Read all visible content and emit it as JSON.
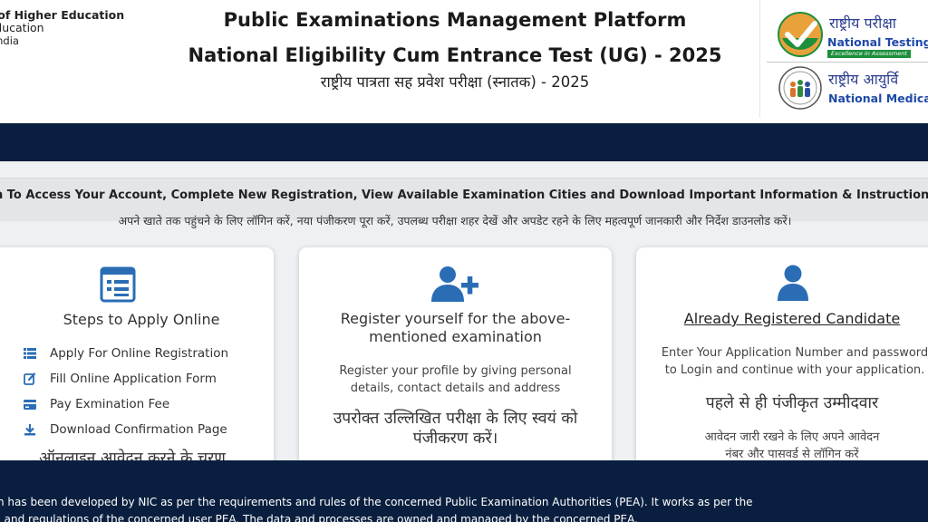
{
  "header": {
    "ministry_line1": "nt of Higher Education",
    "ministry_line2": "f Education",
    "ministry_line3": "of India",
    "title_line1": "Public Examinations Management Platform",
    "title_line2": "National Eligibility Cum Entrance Test (UG) - 2025",
    "title_line3": "राष्ट्रीय पात्रता सह प्रवेश परीक्षा (स्नातक) - 2025",
    "nta_hindi": "राष्ट्रीय परीक्षा",
    "nta_english": "National Testing",
    "nta_tagline": "Excellence in Assessment",
    "nmc_hindi": "राष्ट्रीय आयुर्वि",
    "nmc_english": "National Medica"
  },
  "info": {
    "english": "n To Access Your Account, Complete New Registration, View Available Examination Cities and Download Important Information & Instructions To Stay Update",
    "hindi": "अपने खाते तक पहुंचने के लिए लॉगिन करें, नया पंजीकरण पूरा करें, उपलब्ध परीक्षा शहर देखें और अपडेट रहने के लिए महत्वपूर्ण जानकारी और निर्देश डाउनलोड करें।"
  },
  "cards": {
    "steps": {
      "title": "Steps to Apply Online",
      "icon": "form-icon",
      "items": [
        {
          "label": "Apply For Online Registration",
          "icon": "list-icon"
        },
        {
          "label": "Fill Online Application Form",
          "icon": "edit-icon"
        },
        {
          "label": "Pay Exmination Fee",
          "icon": "card-icon"
        },
        {
          "label": "Download Confirmation Page",
          "icon": "download-icon"
        }
      ],
      "hindi_partial": "ऑनलाइन आवेदन करने के चरण"
    },
    "register": {
      "title": "Register yourself for the above-mentioned examination",
      "icon": "user-plus-icon",
      "text": "Register your profile by giving personal details, contact details and address",
      "hindi": "उपरोक्त उल्लिखित परीक्षा के लिए स्वयं को पंजीकरण करें।"
    },
    "registered": {
      "title": "Already Registered Candidate",
      "icon": "user-icon",
      "text": "Enter Your Application Number and password to Login and continue with your application.",
      "hindi_title": "पहले से ही पंजीकृत उम्मीदवार",
      "hindi_text": "आवेदन जारी रखने के लिए अपने आवेदन नंबर और पासवर्ड से लॉगिन करें"
    }
  },
  "footer": {
    "line1": "n has been developed by NIC as per the requirements and rules of the concerned Public Examination Authorities (PEA). It works as per the",
    "line2": ", and regulations of the concerned user PEA. The data and processes are owned and managed by the concerned PEA."
  },
  "colors": {
    "navy": "#0a1f3f",
    "accent_blue": "#2a6db5",
    "nta_green": "#1d8f3c",
    "nta_blue": "#1f49a8",
    "content_bg": "#eef0f3"
  }
}
